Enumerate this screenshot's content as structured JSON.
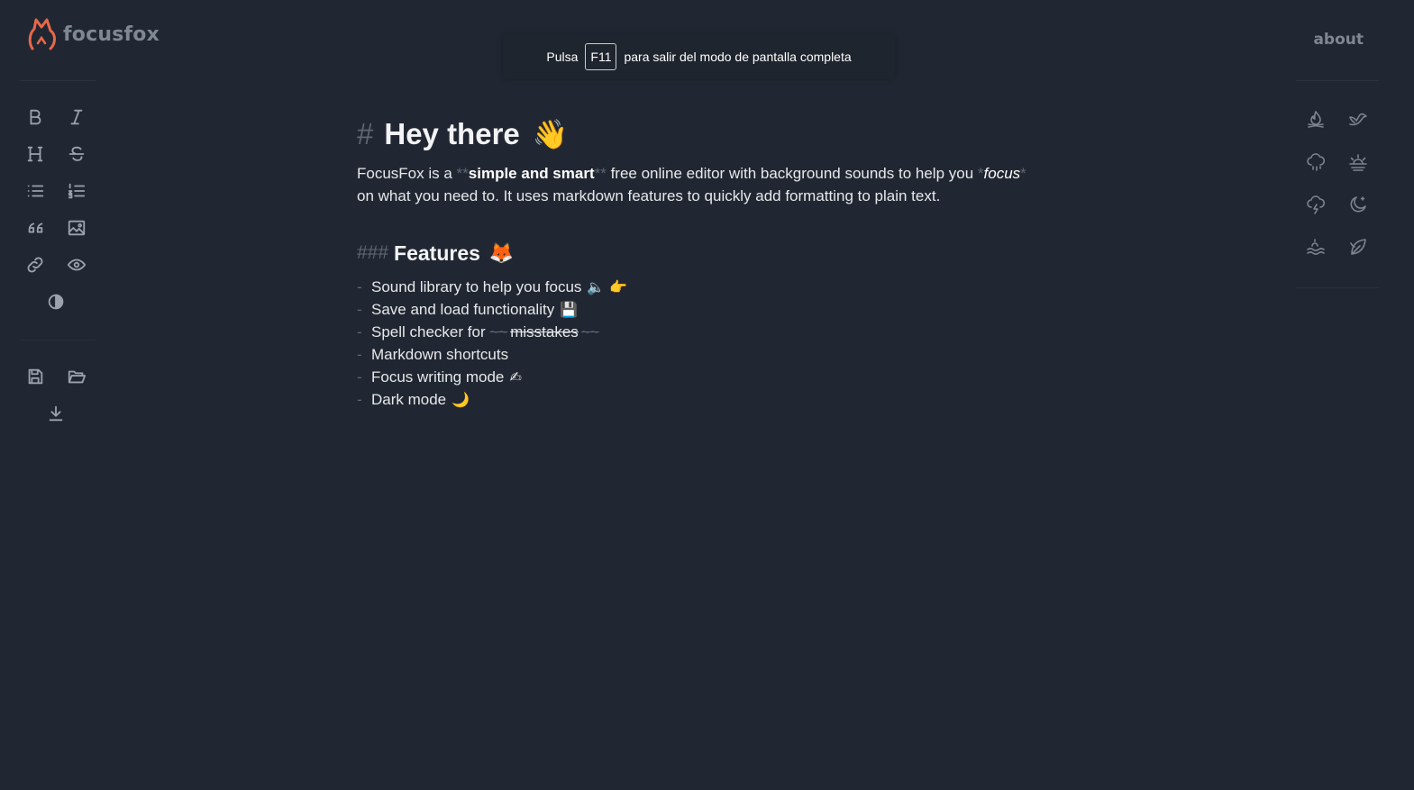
{
  "brand": {
    "name": "focusfox",
    "accent": "#e8684a"
  },
  "nav": {
    "about": "about"
  },
  "notice": {
    "before": "Pulsa",
    "key": "F11",
    "after": "para salir del modo de pantalla completa"
  },
  "toolbar": {
    "format": [
      "bold-icon",
      "italic-icon",
      "heading-icon",
      "strikethrough-icon",
      "bullet-list-icon",
      "numbered-list-icon",
      "quote-icon",
      "image-icon",
      "link-icon",
      "preview-eye-icon"
    ],
    "theme": "contrast-icon",
    "file": [
      "save-icon",
      "open-folder-icon",
      "download-icon"
    ]
  },
  "sounds": [
    "campfire-icon",
    "bird-icon",
    "rain-icon",
    "sunrise-icon",
    "storm-icon",
    "night-icon",
    "waves-icon",
    "leaf-icon"
  ],
  "document": {
    "h1_marker": "#",
    "h1": "Hey there",
    "h1_emoji": "👋",
    "para_1": "FocusFox is a ",
    "bold_marker_open": "**",
    "bold": "simple and smart",
    "bold_marker_close": "**",
    "para_2": " free online editor with background sounds to help you ",
    "italic_marker_open": "*",
    "italic": "focus",
    "italic_marker_close": "*",
    "para_3": "on what you need to. It uses markdown features to quickly add formatting to plain text.",
    "h3_marker": "###",
    "h3": "Features",
    "h3_emoji": "🦊",
    "list_marker": "-",
    "features": [
      {
        "text": "Sound library to help you focus",
        "emoji": "🔈 👉"
      },
      {
        "text": "Save and load functionality",
        "emoji": "💾"
      },
      {
        "text": "Spell checker for ",
        "strike_marker": "~~",
        "strike": "misstakes"
      },
      {
        "text": "Markdown shortcuts",
        "emoji": ""
      },
      {
        "text": "Focus writing mode",
        "emoji": "✍"
      },
      {
        "text": "Dark mode",
        "emoji": "🌙"
      }
    ]
  }
}
